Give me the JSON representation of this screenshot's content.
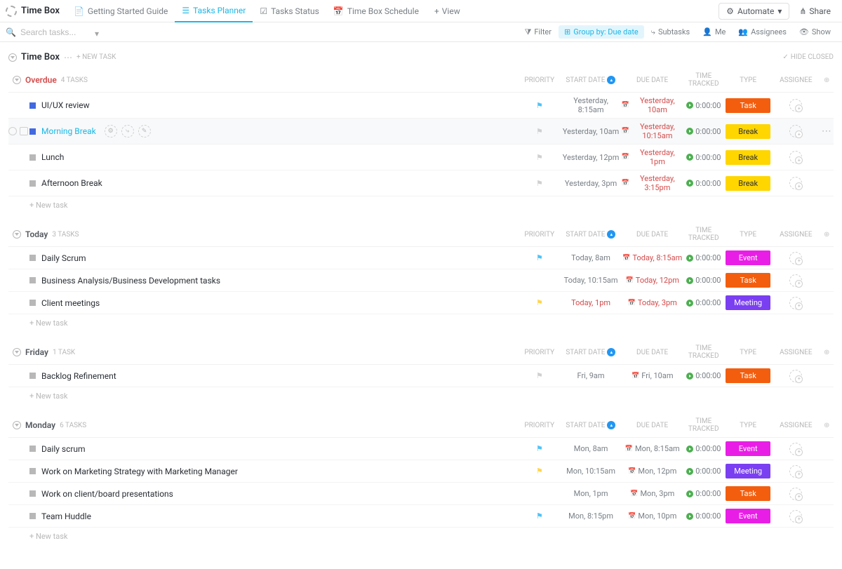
{
  "header": {
    "space": "Time Box",
    "tabs": [
      {
        "label": "Getting Started Guide",
        "active": false
      },
      {
        "label": "Tasks Planner",
        "active": true
      },
      {
        "label": "Tasks Status",
        "active": false
      },
      {
        "label": "Time Box Schedule",
        "active": false
      }
    ],
    "addView": "View",
    "automate": "Automate",
    "share": "Share"
  },
  "toolbar": {
    "searchPlaceholder": "Search tasks...",
    "filter": "Filter",
    "groupBy": "Group by: Due date",
    "subtasks": "Subtasks",
    "me": "Me",
    "assignees": "Assignees",
    "show": "Show"
  },
  "list": {
    "title": "Time Box",
    "newTask": "+ NEW TASK",
    "hideClosed": "HIDE CLOSED"
  },
  "columns": {
    "priority": "PRIORITY",
    "start": "START DATE",
    "due": "DUE DATE",
    "time": "TIME TRACKED",
    "type": "TYPE",
    "assignee": "ASSIGNEE"
  },
  "newTaskRow": "+ New task",
  "zeroTime": "0:00:00",
  "groups": [
    {
      "name": "Overdue",
      "count": "4 TASKS",
      "overdue": true,
      "rows": [
        {
          "name": "UI/UX review",
          "status": "blue",
          "flag": "blue",
          "start": "Yesterday, 8:15am",
          "due": "Yesterday, 10am",
          "dueRed": true,
          "type": "Task",
          "typeClass": "task"
        },
        {
          "name": "Morning Break",
          "status": "blue",
          "flag": "grey",
          "start": "Yesterday, 10am",
          "due": "Yesterday, 10:15am",
          "dueRed": true,
          "type": "Break",
          "typeClass": "break",
          "active": true,
          "hover": true,
          "showCheck": true,
          "showActions": true,
          "showMore": true
        },
        {
          "name": "Lunch",
          "status": "grey",
          "flag": "grey",
          "start": "Yesterday, 12pm",
          "due": "Yesterday, 1pm",
          "dueRed": true,
          "type": "Break",
          "typeClass": "break"
        },
        {
          "name": "Afternoon Break",
          "status": "grey",
          "flag": "grey",
          "start": "Yesterday, 3pm",
          "due": "Yesterday, 3:15pm",
          "dueRed": true,
          "type": "Break",
          "typeClass": "break"
        }
      ]
    },
    {
      "name": "Today",
      "count": "3 TASKS",
      "overdue": false,
      "rows": [
        {
          "name": "Daily Scrum",
          "status": "grey",
          "flag": "blue",
          "start": "Today, 8am",
          "due": "Today, 8:15am",
          "dueRed": true,
          "type": "Event",
          "typeClass": "event"
        },
        {
          "name": "Business Analysis/Business Development tasks",
          "status": "grey",
          "flag": "",
          "start": "Today, 10:15am",
          "due": "Today, 12pm",
          "dueRed": true,
          "type": "Task",
          "typeClass": "task"
        },
        {
          "name": "Client meetings",
          "status": "grey",
          "flag": "yellow",
          "start": "Today, 1pm",
          "startRed": true,
          "due": "Today, 3pm",
          "dueRed": true,
          "type": "Meeting",
          "typeClass": "meeting"
        }
      ]
    },
    {
      "name": "Friday",
      "count": "1 TASK",
      "overdue": false,
      "rows": [
        {
          "name": "Backlog Refinement",
          "status": "grey",
          "flag": "grey",
          "start": "Fri, 9am",
          "due": "Fri, 10am",
          "dueRed": false,
          "type": "Task",
          "typeClass": "task"
        }
      ]
    },
    {
      "name": "Monday",
      "count": "6 TASKS",
      "overdue": false,
      "rows": [
        {
          "name": "Daily scrum",
          "status": "grey",
          "flag": "blue",
          "start": "Mon, 8am",
          "due": "Mon, 8:15am",
          "dueRed": false,
          "type": "Event",
          "typeClass": "event"
        },
        {
          "name": "Work on Marketing Strategy with Marketing Manager",
          "status": "grey",
          "flag": "yellow",
          "start": "Mon, 10:15am",
          "due": "Mon, 12pm",
          "dueRed": false,
          "type": "Meeting",
          "typeClass": "meeting"
        },
        {
          "name": "Work on client/board presentations",
          "status": "grey",
          "flag": "",
          "start": "Mon, 1pm",
          "due": "Mon, 3pm",
          "dueRed": false,
          "type": "Task",
          "typeClass": "task"
        },
        {
          "name": "Team Huddle",
          "status": "grey",
          "flag": "blue",
          "start": "Mon, 8:15pm",
          "due": "Mon, 10pm",
          "dueRed": false,
          "type": "Event",
          "typeClass": "event"
        }
      ]
    }
  ]
}
